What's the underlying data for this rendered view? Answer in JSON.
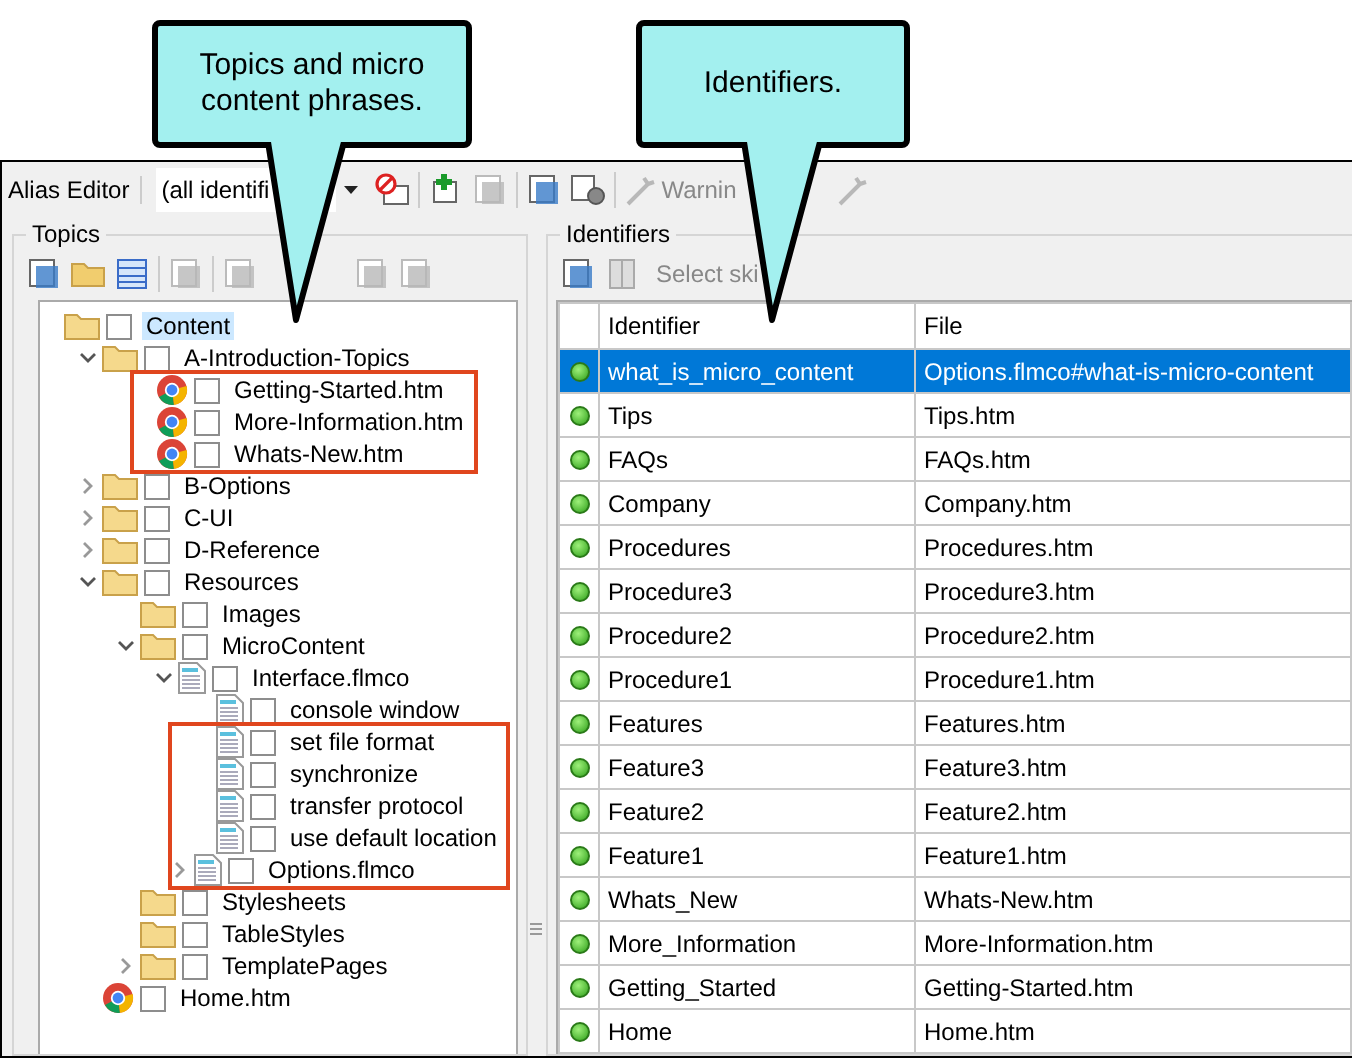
{
  "callouts": [
    {
      "text": "Topics and micro content phrases."
    },
    {
      "text": "Identifiers."
    }
  ],
  "window": {
    "title": "Alias Editor"
  },
  "toolbar": {
    "filter": "(all identifi",
    "warnings": "Warnin"
  },
  "topics": {
    "label": "Topics",
    "tree": [
      {
        "label": "Content",
        "kind": "folder",
        "checked": false,
        "selected": true,
        "highlighted": false,
        "children": [
          {
            "label": "A-Introduction-Topics",
            "kind": "folder",
            "expanded": true,
            "checked": false,
            "selected": false,
            "highlighted": false,
            "children": [
              {
                "label": "Getting-Started.htm",
                "kind": "page",
                "checked": false,
                "selected": false,
                "highlighted": true
              },
              {
                "label": "More-Information.htm",
                "kind": "page",
                "checked": false,
                "selected": false,
                "highlighted": true
              },
              {
                "label": "Whats-New.htm",
                "kind": "page",
                "checked": false,
                "selected": false,
                "highlighted": true
              }
            ]
          },
          {
            "label": "B-Options",
            "kind": "folder",
            "expanded": false,
            "checked": false,
            "selected": false,
            "highlighted": false
          },
          {
            "label": "C-UI",
            "kind": "folder",
            "expanded": false,
            "checked": false,
            "selected": false,
            "highlighted": false
          },
          {
            "label": "D-Reference",
            "kind": "folder",
            "expanded": false,
            "checked": false,
            "selected": false,
            "highlighted": false
          },
          {
            "label": "Resources",
            "kind": "folder",
            "expanded": true,
            "checked": false,
            "selected": false,
            "highlighted": false,
            "children": [
              {
                "label": "Images",
                "kind": "folder",
                "checked": false,
                "selected": false,
                "highlighted": false
              },
              {
                "label": "MicroContent",
                "kind": "folder",
                "expanded": true,
                "checked": false,
                "selected": false,
                "highlighted": false,
                "children": [
                  {
                    "label": "Interface.flmco",
                    "kind": "doc",
                    "expanded": true,
                    "checked": false,
                    "selected": false,
                    "highlighted": false,
                    "children": [
                      {
                        "label": "console window",
                        "kind": "doc",
                        "checked": false,
                        "selected": false,
                        "highlighted": false
                      },
                      {
                        "label": "set file format",
                        "kind": "doc",
                        "checked": false,
                        "selected": false,
                        "highlighted": true
                      },
                      {
                        "label": "synchronize",
                        "kind": "doc",
                        "checked": false,
                        "selected": false,
                        "highlighted": true
                      },
                      {
                        "label": "transfer protocol",
                        "kind": "doc",
                        "checked": false,
                        "selected": false,
                        "highlighted": true
                      },
                      {
                        "label": "use default location",
                        "kind": "doc",
                        "checked": false,
                        "selected": false,
                        "highlighted": true
                      }
                    ]
                  },
                  {
                    "label": "Options.flmco",
                    "kind": "doc",
                    "expanded": false,
                    "checked": false,
                    "selected": false,
                    "highlighted": true
                  }
                ]
              },
              {
                "label": "Stylesheets",
                "kind": "folder",
                "checked": false,
                "selected": false,
                "highlighted": false
              },
              {
                "label": "TableStyles",
                "kind": "folder",
                "checked": false,
                "selected": false,
                "highlighted": false
              },
              {
                "label": "TemplatePages",
                "kind": "folder",
                "expanded": false,
                "checked": false,
                "selected": false,
                "highlighted": false
              }
            ]
          },
          {
            "label": "Home.htm",
            "kind": "page",
            "checked": false,
            "selected": false,
            "highlighted": false
          }
        ]
      }
    ]
  },
  "identifiers": {
    "label": "Identifiers",
    "skin": "Select ski",
    "columns": [
      "Identifier",
      "File"
    ],
    "rows": [
      {
        "identifier": "what_is_micro_content",
        "file": "Options.flmco#what-is-micro-content",
        "selected": true
      },
      {
        "identifier": "Tips",
        "file": "Tips.htm",
        "selected": false
      },
      {
        "identifier": "FAQs",
        "file": "FAQs.htm",
        "selected": false
      },
      {
        "identifier": "Company",
        "file": "Company.htm",
        "selected": false
      },
      {
        "identifier": "Procedures",
        "file": "Procedures.htm",
        "selected": false
      },
      {
        "identifier": "Procedure3",
        "file": "Procedure3.htm",
        "selected": false
      },
      {
        "identifier": "Procedure2",
        "file": "Procedure2.htm",
        "selected": false
      },
      {
        "identifier": "Procedure1",
        "file": "Procedure1.htm",
        "selected": false
      },
      {
        "identifier": "Features",
        "file": "Features.htm",
        "selected": false
      },
      {
        "identifier": "Feature3",
        "file": "Feature3.htm",
        "selected": false
      },
      {
        "identifier": "Feature2",
        "file": "Feature2.htm",
        "selected": false
      },
      {
        "identifier": "Feature1",
        "file": "Feature1.htm",
        "selected": false
      },
      {
        "identifier": "Whats_New",
        "file": "Whats-New.htm",
        "selected": false
      },
      {
        "identifier": "More_Information",
        "file": "More-Information.htm",
        "selected": false
      },
      {
        "identifier": "Getting_Started",
        "file": "Getting-Started.htm",
        "selected": false
      },
      {
        "identifier": "Home",
        "file": "Home.htm",
        "selected": false
      }
    ]
  }
}
